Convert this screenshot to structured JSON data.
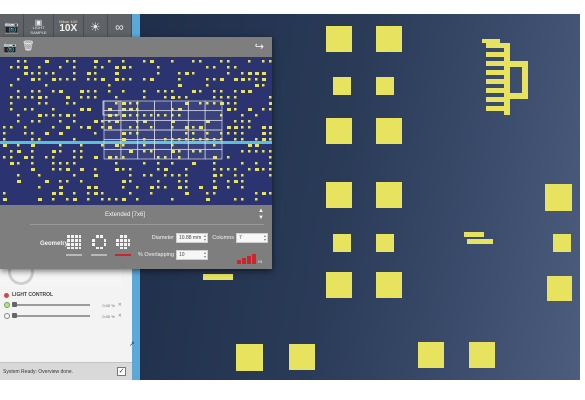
{
  "toolbar": {
    "tiles": {
      "line1": "LIGHT",
      "line2": "SAMPLE"
    },
    "objective": {
      "line1": "Nikon 10X",
      "magnification": "10X"
    }
  },
  "overview": {
    "mode_label": "Extended [7x6]",
    "geometry_label": "Geometry",
    "diameter_label": "Diameter",
    "diameter_value": "10.88 mm",
    "columns_label": "Columns",
    "columns_value": "7",
    "overlapping_label": "% Overlapping",
    "overlapping_value": "10",
    "grid": {
      "columns": 7,
      "rows": 6
    }
  },
  "light_control": {
    "title": "LIGHT CONTROL",
    "channels": [
      {
        "value": "0.00 %"
      },
      {
        "value": "0.00 %"
      }
    ]
  },
  "status": {
    "text": "System Ready: Overview done."
  },
  "colors": {
    "pad": "#e8e35f",
    "live_bg": "#2a3b58",
    "overview_bg": "#2b3470",
    "panel": "#7e7e7e",
    "accent_blue": "#5aa9d8",
    "selection_red": "#c8262d"
  },
  "icons": {
    "toolbar": [
      "camera-icon",
      "tiles-icon",
      "objective-icon",
      "brightness-icon",
      "link-icon"
    ],
    "overview": [
      "camera-icon",
      "trash-icon",
      "export-icon",
      "chevron-updown-icon"
    ]
  }
}
